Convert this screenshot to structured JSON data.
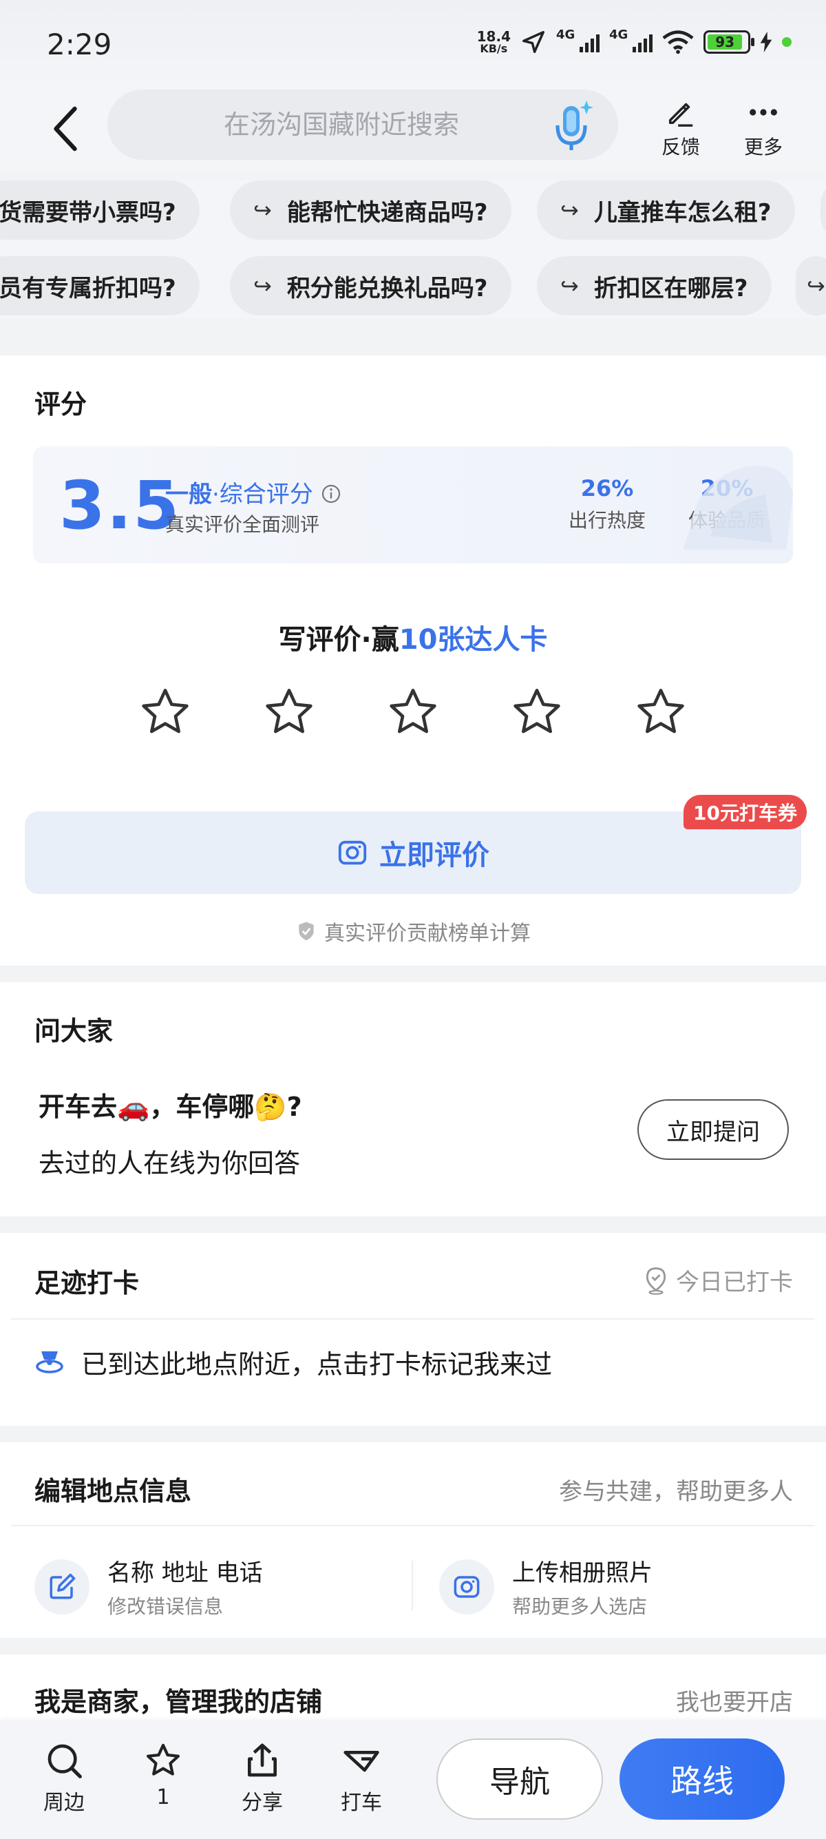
{
  "status": {
    "time": "2:29",
    "net_speed_value": "18.4",
    "net_speed_unit": "KB/s",
    "sig1": "4G",
    "sig2": "4G",
    "battery": "93"
  },
  "header": {
    "search_placeholder": "在汤沟国藏附近搜索",
    "feedback_label": "反馈",
    "more_label": "更多"
  },
  "chips": {
    "row1": [
      "货需要带小票吗?",
      "能帮忙快递商品吗?",
      "儿童推车怎么租?"
    ],
    "row2": [
      "员有专属折扣吗?",
      "积分能兑换礼品吗?",
      "折扣区在哪层?"
    ]
  },
  "rating": {
    "title": "评分",
    "score": "3.5",
    "level": "一般",
    "level_suffix": "·综合评分",
    "subtitle": "真实评价全面测评",
    "stat1_value": "26%",
    "stat1_label": "出行热度",
    "stat2_value": "20%",
    "stat2_label": "体验品质",
    "promo_prefix": "写评价·赢",
    "promo_highlight": "10张达人卡",
    "star_count": 5,
    "review_button": "立即评价",
    "coupon_badge": "10元打车券",
    "verify_note": "真实评价贡献榜单计算"
  },
  "ask": {
    "title": "问大家",
    "question": "开车去🚗，车停哪🤔?",
    "subtitle": "去过的人在线为你回答",
    "button": "立即提问"
  },
  "footprint": {
    "title": "足迹打卡",
    "status": "今日已打卡",
    "row_text": "已到达此地点附近，点击打卡标记我来过"
  },
  "edit": {
    "title": "编辑地点信息",
    "right": "参与共建，帮助更多人",
    "item1_title": "名称 地址 电话",
    "item1_sub": "修改错误信息",
    "item2_title": "上传相册照片",
    "item2_sub": "帮助更多人选店"
  },
  "merchant": {
    "title": "我是商家，管理我的店铺",
    "right": "我也要开店"
  },
  "bottom": {
    "nearby": "周边",
    "favorite": "1",
    "share": "分享",
    "taxi": "打车",
    "navigate": "导航",
    "route": "路线"
  },
  "colors": {
    "accent": "#3a72e8",
    "coupon": "#ec4b4b",
    "route_btn": "#3070f0"
  }
}
